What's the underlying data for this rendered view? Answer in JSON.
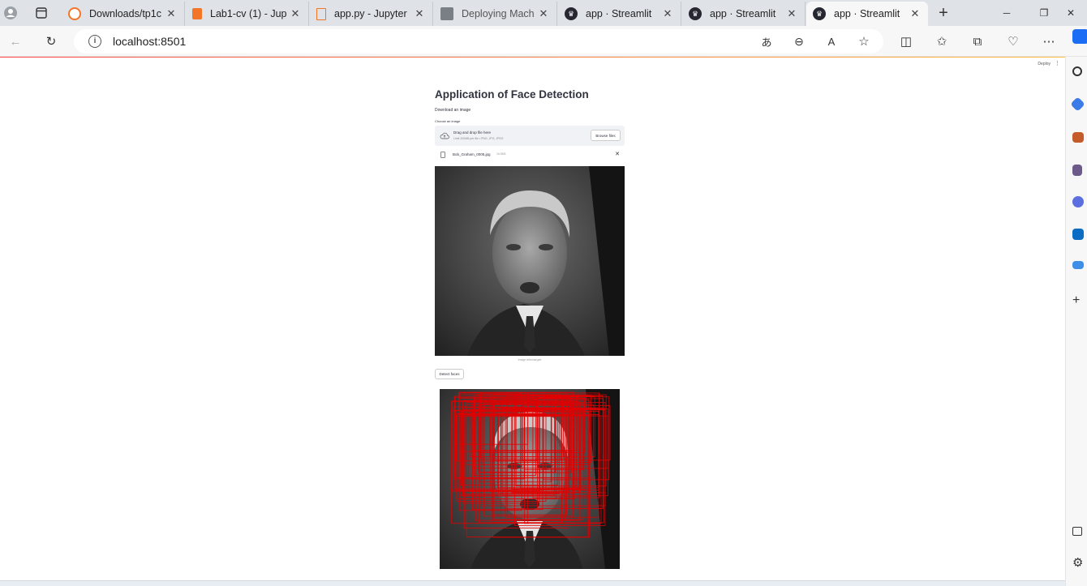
{
  "browser": {
    "tabs": [
      {
        "title": "Downloads/tp1c",
        "icon": "jupyter-icon",
        "active": false
      },
      {
        "title": "Lab1-cv (1) - Jup",
        "icon": "notebook-icon",
        "active": false
      },
      {
        "title": "app.py - Jupyter",
        "icon": "file-icon",
        "active": false
      },
      {
        "title": "Deploying Mach",
        "icon": "article-icon",
        "active": false
      },
      {
        "title": "app · Streamlit",
        "icon": "streamlit-icon",
        "active": false
      },
      {
        "title": "app · Streamlit",
        "icon": "streamlit-icon",
        "active": false
      },
      {
        "title": "app · Streamlit",
        "icon": "streamlit-icon",
        "active": true
      }
    ],
    "url": "localhost:8501"
  },
  "app": {
    "deploy_label": "Deploy",
    "title": "Application of Face Detection",
    "subtitle": "Download an image",
    "uploader": {
      "label": "Choose an image",
      "drop_text": "Drag and drop file here",
      "limit_text": "Limit 200MB per file • PNG, JPG, JPEG",
      "browse_label": "Browse files"
    },
    "file": {
      "name": "Bob_Graham_0005.jpg",
      "size": "16.5KB"
    },
    "caption": "Image téléchargée",
    "detect_button": "Detect faces"
  },
  "colors": {
    "accent": "#ff4b4b",
    "box": "#e00000"
  }
}
